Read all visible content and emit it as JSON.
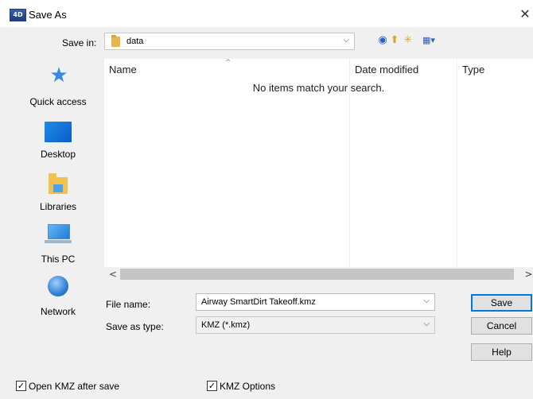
{
  "window": {
    "title": "Save As",
    "app_icon_text": "4D",
    "close_glyph": "✕"
  },
  "save_in": {
    "label": "Save in:",
    "value": "data",
    "chevron": "⌵"
  },
  "toolbar": {
    "back_glyph": "◉",
    "up_glyph": "⬆",
    "new_folder_glyph": "✳",
    "views_glyph": "▦▾"
  },
  "places": [
    {
      "label": "Quick access",
      "icon": "star-icon"
    },
    {
      "label": "Desktop",
      "icon": "desktop-icon"
    },
    {
      "label": "Libraries",
      "icon": "libraries-icon"
    },
    {
      "label": "This PC",
      "icon": "computer-icon"
    },
    {
      "label": "Network",
      "icon": "network-icon"
    }
  ],
  "file_list": {
    "columns": [
      "Name",
      "Date modified",
      "Type"
    ],
    "sort_glyph": "^",
    "empty_message": "No items match your search.",
    "scroll_left": "<",
    "scroll_right": ">"
  },
  "file_name": {
    "label": "File name:",
    "value": "Airway SmartDirt Takeoff.kmz",
    "chevron": "⌵"
  },
  "save_as_type": {
    "label": "Save as type:",
    "value": "KMZ (*.kmz)",
    "chevron": "⌵"
  },
  "buttons": {
    "save": "Save",
    "cancel": "Cancel",
    "help": "Help"
  },
  "options": {
    "open_kmz": {
      "label": "Open KMZ after save",
      "checked": true
    },
    "kmz_options": {
      "label": "KMZ Options",
      "checked": true
    },
    "check_glyph": "✓"
  },
  "colors": {
    "accent": "#0078d7",
    "dialog_bg": "#f0f0f0"
  }
}
